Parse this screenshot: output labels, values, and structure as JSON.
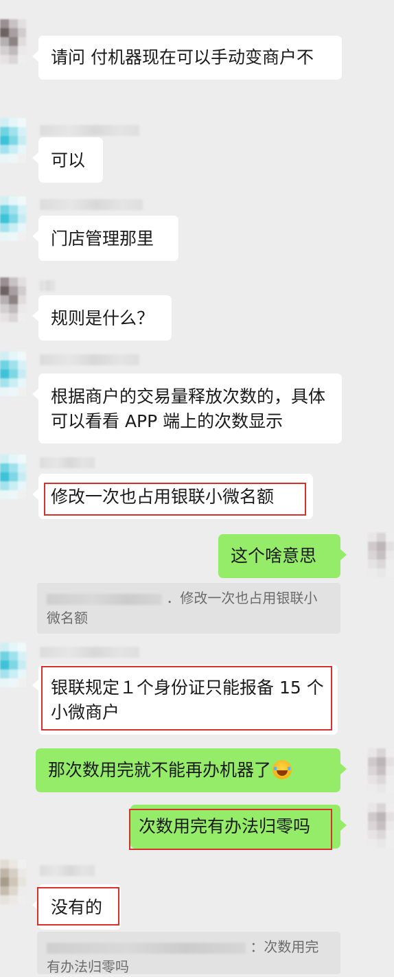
{
  "messages": [
    {
      "id": "m1",
      "side": "in",
      "text": "请问  付机器现在可以手动变商户不"
    },
    {
      "id": "m2",
      "side": "in",
      "text": "可以"
    },
    {
      "id": "m3",
      "side": "in",
      "text": "门店管理那里"
    },
    {
      "id": "m4",
      "side": "in",
      "text": "规则是什么？"
    },
    {
      "id": "m5",
      "side": "in",
      "text": "根据商户的交易量释放次数的，具体可以看看 APP 端上的次数显示"
    },
    {
      "id": "m6",
      "side": "in",
      "text": "修改一次也占用银联小微名额"
    },
    {
      "id": "m7",
      "side": "out",
      "text": "这个啥意思"
    },
    {
      "id": "m8",
      "side": "in",
      "text": "银联规定１个身份证只能报备 15 个小微商户"
    },
    {
      "id": "m9",
      "side": "out",
      "text": "那次数用完就不能再办机器了",
      "emoji": "tears-of-joy-emoji"
    },
    {
      "id": "m10",
      "side": "out",
      "text": "次数用完有办法归零吗"
    },
    {
      "id": "m11",
      "side": "in",
      "text": "没有的"
    }
  ],
  "quotes": [
    {
      "id": "q1",
      "text": "．修改一次也占用银联小微名额"
    },
    {
      "id": "q2",
      "text": "：次数用完有办法归零吗"
    }
  ],
  "colors": {
    "background": "#ededed",
    "incoming_bubble": "#ffffff",
    "outgoing_bubble": "#95ec69",
    "highlight_box": "#d6302b"
  }
}
